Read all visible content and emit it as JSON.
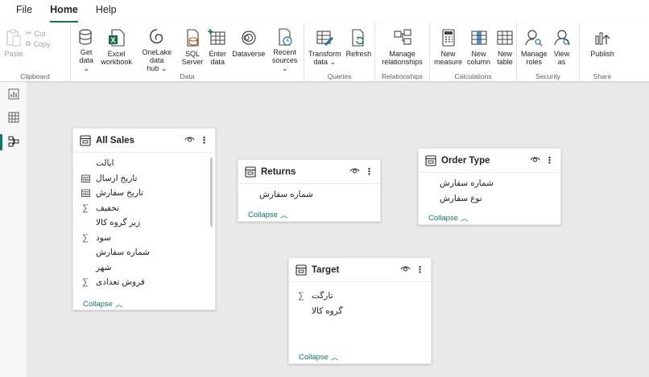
{
  "menu": {
    "tabs": [
      "File",
      "Home",
      "Help"
    ],
    "active": "Home"
  },
  "ribbon": {
    "clipboard": {
      "label": "Clipboard",
      "paste": "Paste",
      "cut": "Cut",
      "copy": "Copy"
    },
    "data": {
      "label": "Data",
      "buttons": [
        "Get\ndata ⌄",
        "Excel\nworkbook",
        "OneLake data\nhub ⌄",
        "SQL\nServer",
        "Enter\ndata",
        "Dataverse",
        "Recent\nsources ⌄"
      ]
    },
    "queries": {
      "label": "Queries",
      "buttons": [
        "Transform\ndata ⌄",
        "Refresh"
      ]
    },
    "relationships": {
      "label": "Relationships",
      "buttons": [
        "Manage\nrelationships"
      ]
    },
    "calculations": {
      "label": "Calculations",
      "buttons": [
        "New\nmeasure",
        "New\ncolumn",
        "New\ntable"
      ]
    },
    "security": {
      "label": "Security",
      "buttons": [
        "Manage\nroles",
        "View\nas"
      ]
    },
    "share": {
      "label": "Share",
      "buttons": [
        "Publish"
      ]
    }
  },
  "colors": {
    "accent": "#117865",
    "excel": "#1d6f42",
    "blue": "#1f6fb5"
  },
  "tables": {
    "all_sales": {
      "title": "All Sales",
      "collapse": "Collapse",
      "fields": [
        {
          "name": "ایالت",
          "icon": ""
        },
        {
          "name": "تاریخ ارسال",
          "icon": "calendar-icon"
        },
        {
          "name": "تاریخ سفارش",
          "icon": "calendar-icon"
        },
        {
          "name": "تخفیف",
          "icon": "sigma-icon"
        },
        {
          "name": "زیر گروه کالا",
          "icon": ""
        },
        {
          "name": "سود",
          "icon": "sigma-icon"
        },
        {
          "name": "شماره سفارش",
          "icon": ""
        },
        {
          "name": "شهر",
          "icon": ""
        },
        {
          "name": "فروش تعدادی",
          "icon": "sigma-icon"
        }
      ]
    },
    "returns": {
      "title": "Returns",
      "collapse": "Collapse",
      "fields": [
        {
          "name": "شماره سفارش",
          "icon": ""
        }
      ]
    },
    "order_type": {
      "title": "Order Type",
      "collapse": "Collapse",
      "fields": [
        {
          "name": "شماره سفارش",
          "icon": ""
        },
        {
          "name": "نوع سفارش",
          "icon": ""
        }
      ]
    },
    "target": {
      "title": "Target",
      "collapse": "Collapse",
      "fields": [
        {
          "name": "تارگت",
          "icon": "sigma-icon"
        },
        {
          "name": "گروه کالا",
          "icon": ""
        }
      ]
    }
  }
}
